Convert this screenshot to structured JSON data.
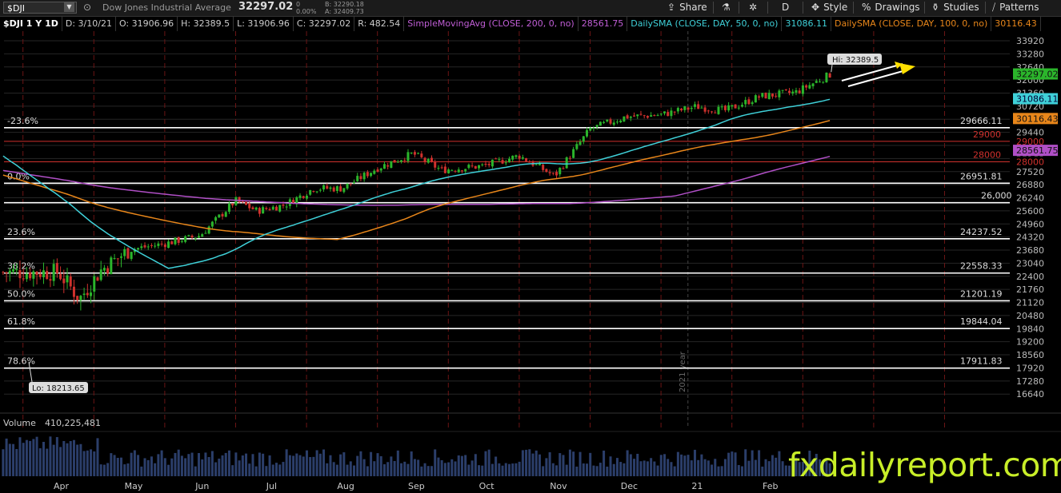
{
  "toolbar": {
    "symbol": "$DJI",
    "company": "Dow Jones Industrial Average",
    "last": "32297.02",
    "change": "0",
    "change_pct": "0.00%",
    "bid": "B: 32290.18",
    "ask": "A: 32409.73",
    "share": "Share",
    "timeframe": "D",
    "style": "Style",
    "drawings": "Drawings",
    "studies": "Studies",
    "patterns": "Patterns"
  },
  "infobar": {
    "title": "$DJI 1 Y 1D",
    "date": "D: 3/10/21",
    "open": "O: 31906.96",
    "high": "H: 32389.5",
    "low": "L: 31906.96",
    "close": "C: 32297.02",
    "range": "R: 482.54",
    "sma200_label": "SimpleMovingAvg (CLOSE, 200, 0, no)",
    "sma200_value": "28561.75",
    "sma50_label": "DailySMA (CLOSE, DAY, 50, 0, no)",
    "sma50_value": "31086.11",
    "sma100_label": "DailySMA (CLOSE, DAY, 100, 0, no)",
    "sma100_value": "30116.43"
  },
  "colors": {
    "up": "#2bb52b",
    "down": "#d0312d",
    "sma50": "#3fd0d8",
    "sma100": "#e8861a",
    "sma200": "#b04fc6",
    "fib": "#ffffff",
    "resistance": "#d0312d",
    "grid": "#262626",
    "month_line": "#6b1515",
    "price_box": "#2bb52b"
  },
  "chart_data": {
    "type": "candlestick",
    "symbol": "$DJI",
    "ylim": [
      16000,
      34500
    ],
    "y_ticks": [
      33920,
      33280,
      32640,
      32000,
      31360,
      30720,
      30080,
      29440,
      28800,
      28160,
      27520,
      26880,
      26240,
      25600,
      24960,
      24320,
      23680,
      23040,
      22400,
      21760,
      21120,
      20480,
      19840,
      19200,
      18560,
      17920,
      17280,
      16640
    ],
    "x_months": [
      "Apr",
      "May",
      "Jun",
      "Jul",
      "Aug",
      "Sep",
      "Oct",
      "Nov",
      "Dec",
      "21",
      "Feb"
    ],
    "separator_label": "2021 year",
    "fib_levels": [
      {
        "label": "-23.6%",
        "value": 29666.11
      },
      {
        "label": "0.0%",
        "value": 26951.81
      },
      {
        "label": "23.6%",
        "value": 24237.52
      },
      {
        "label": "38.2%",
        "value": 22558.33
      },
      {
        "label": "50.0%",
        "value": 21201.19
      },
      {
        "label": "61.8%",
        "value": 19844.04
      },
      {
        "label": "78.6%",
        "value": 17911.83
      }
    ],
    "horizontal_lines": [
      {
        "label": "29000",
        "value": 29000,
        "color": "red"
      },
      {
        "label": "28000",
        "value": 28000,
        "color": "red"
      },
      {
        "label": "26,000",
        "value": 26000,
        "color": "white"
      }
    ],
    "hi_annotation": "Hi: 32389.5",
    "lo_annotation": "Lo: 18213.65",
    "price_boxes": [
      {
        "value": 32297.02,
        "text": "32297.02",
        "kind": "last"
      },
      {
        "value": 31086.11,
        "text": "31086.11",
        "kind": "sma50"
      },
      {
        "value": 30116.43,
        "text": "30116.43",
        "kind": "sma100"
      },
      {
        "value": 29000,
        "text": "29000",
        "kind": "resist"
      },
      {
        "value": 28000,
        "text": "28000",
        "kind": "resist"
      },
      {
        "value": 28561.75,
        "text": "28561.75",
        "kind": "sma200"
      }
    ],
    "closes_approx": [
      {
        "m": 0,
        "c": 22600
      },
      {
        "m": 0.3,
        "c": 21300
      },
      {
        "m": 0.6,
        "c": 22700
      },
      {
        "m": 1.0,
        "c": 23700
      },
      {
        "m": 1.5,
        "c": 24000
      },
      {
        "m": 2.0,
        "c": 24400
      },
      {
        "m": 2.5,
        "c": 26100
      },
      {
        "m": 2.8,
        "c": 25600
      },
      {
        "m": 3.2,
        "c": 25900
      },
      {
        "m": 3.6,
        "c": 26700
      },
      {
        "m": 4.0,
        "c": 26700
      },
      {
        "m": 4.5,
        "c": 27700
      },
      {
        "m": 5.0,
        "c": 28400
      },
      {
        "m": 5.4,
        "c": 27600
      },
      {
        "m": 6.0,
        "c": 27800
      },
      {
        "m": 6.5,
        "c": 28300
      },
      {
        "m": 7.0,
        "c": 27300
      },
      {
        "m": 7.5,
        "c": 29600
      },
      {
        "m": 8.0,
        "c": 30200
      },
      {
        "m": 8.5,
        "c": 30300
      },
      {
        "m": 9.0,
        "c": 30700
      },
      {
        "m": 9.4,
        "c": 30500
      },
      {
        "m": 9.9,
        "c": 31200
      },
      {
        "m": 10.4,
        "c": 31400
      },
      {
        "m": 10.9,
        "c": 32297
      }
    ],
    "volume_label": "Volume",
    "volume_value": "410,225,481"
  },
  "watermark": "fxdailyreport.com"
}
